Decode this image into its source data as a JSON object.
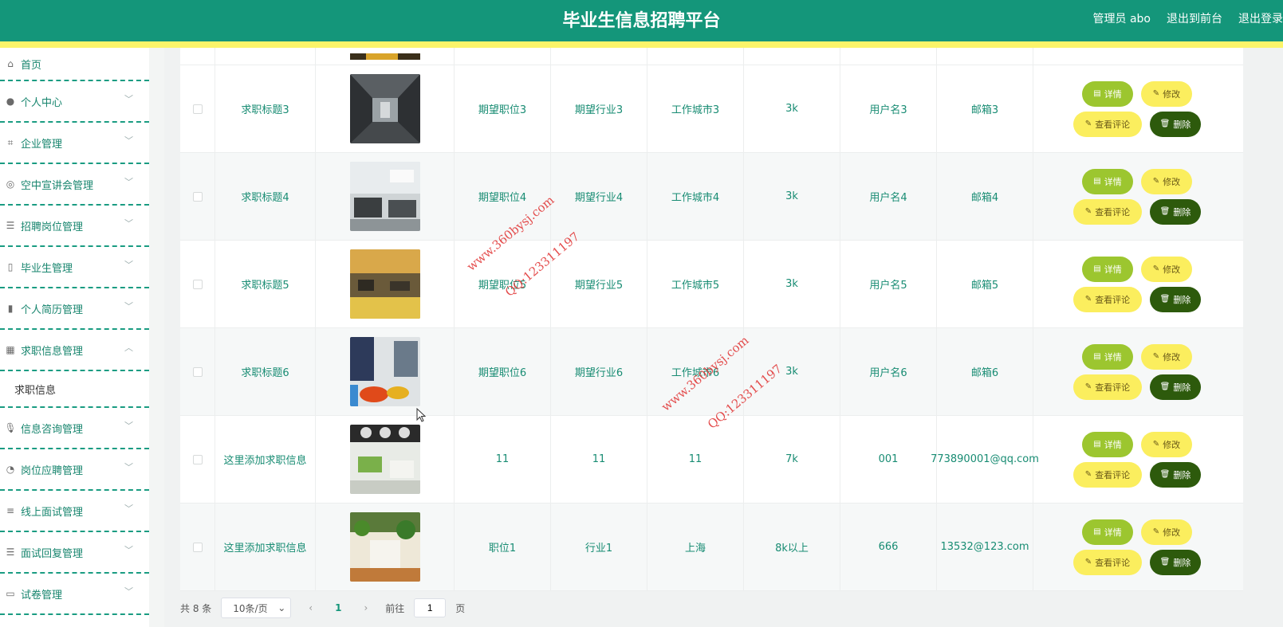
{
  "header": {
    "title": "毕业生信息招聘平台",
    "admin_label": "管理员 abo",
    "front_label": "退出到前台",
    "logout_label": "退出登录"
  },
  "sidebar": {
    "items": [
      {
        "label": "首页",
        "icon": "home-icon"
      },
      {
        "label": "个人中心",
        "icon": "user-icon"
      },
      {
        "label": "企业管理",
        "icon": "crop-icon"
      },
      {
        "label": "空中宣讲会管理",
        "icon": "lifebuoy-icon"
      },
      {
        "label": "招聘岗位管理",
        "icon": "sliders-icon"
      },
      {
        "label": "毕业生管理",
        "icon": "battery-icon"
      },
      {
        "label": "个人简历管理",
        "icon": "bar-chart-icon"
      },
      {
        "label": "求职信息管理",
        "icon": "grid-icon",
        "expanded": true
      },
      {
        "label": "信息咨询管理",
        "icon": "microphone-icon"
      },
      {
        "label": "岗位应聘管理",
        "icon": "gauge-icon"
      },
      {
        "label": "线上面试管理",
        "icon": "list-icon"
      },
      {
        "label": "面试回复管理",
        "icon": "menu-icon"
      },
      {
        "label": "试卷管理",
        "icon": "monitor-icon"
      }
    ],
    "submenu_label": "求职信息"
  },
  "table": {
    "rows": [
      {
        "title": "求职标题3",
        "position": "期望职位3",
        "industry": "期望行业3",
        "city": "工作城市3",
        "salary": "3k",
        "user": "用户名3",
        "email": "邮箱3"
      },
      {
        "title": "求职标题4",
        "position": "期望职位4",
        "industry": "期望行业4",
        "city": "工作城市4",
        "salary": "3k",
        "user": "用户名4",
        "email": "邮箱4"
      },
      {
        "title": "求职标题5",
        "position": "期望职位5",
        "industry": "期望行业5",
        "city": "工作城市5",
        "salary": "3k",
        "user": "用户名5",
        "email": "邮箱5"
      },
      {
        "title": "求职标题6",
        "position": "期望职位6",
        "industry": "期望行业6",
        "city": "工作城市6",
        "salary": "3k",
        "user": "用户名6",
        "email": "邮箱6"
      },
      {
        "title": "这里添加求职信息",
        "position": "11",
        "industry": "11",
        "city": "11",
        "salary": "7k",
        "user": "001",
        "email": "773890001@qq.com"
      },
      {
        "title": "这里添加求职信息",
        "position": "职位1",
        "industry": "行业1",
        "city": "上海",
        "salary": "8k以上",
        "user": "666",
        "email": "13532@123.com"
      }
    ],
    "actions": {
      "detail": "详情",
      "edit": "修改",
      "comment": "查看评论",
      "delete": "删除"
    }
  },
  "pagination": {
    "total": "共 8 条",
    "page_size": "10条/页",
    "current_page": "1",
    "goto_prefix": "前往",
    "goto_value": "1",
    "goto_suffix": "页"
  },
  "watermark": {
    "site": "www.360bysj.com",
    "qq": "QQ:123311197"
  },
  "colors": {
    "header": "#14967a",
    "stripe": "#fbf46a",
    "detail": "#9cc62f",
    "edit": "#fbee5e",
    "delete": "#2d5a0c"
  }
}
